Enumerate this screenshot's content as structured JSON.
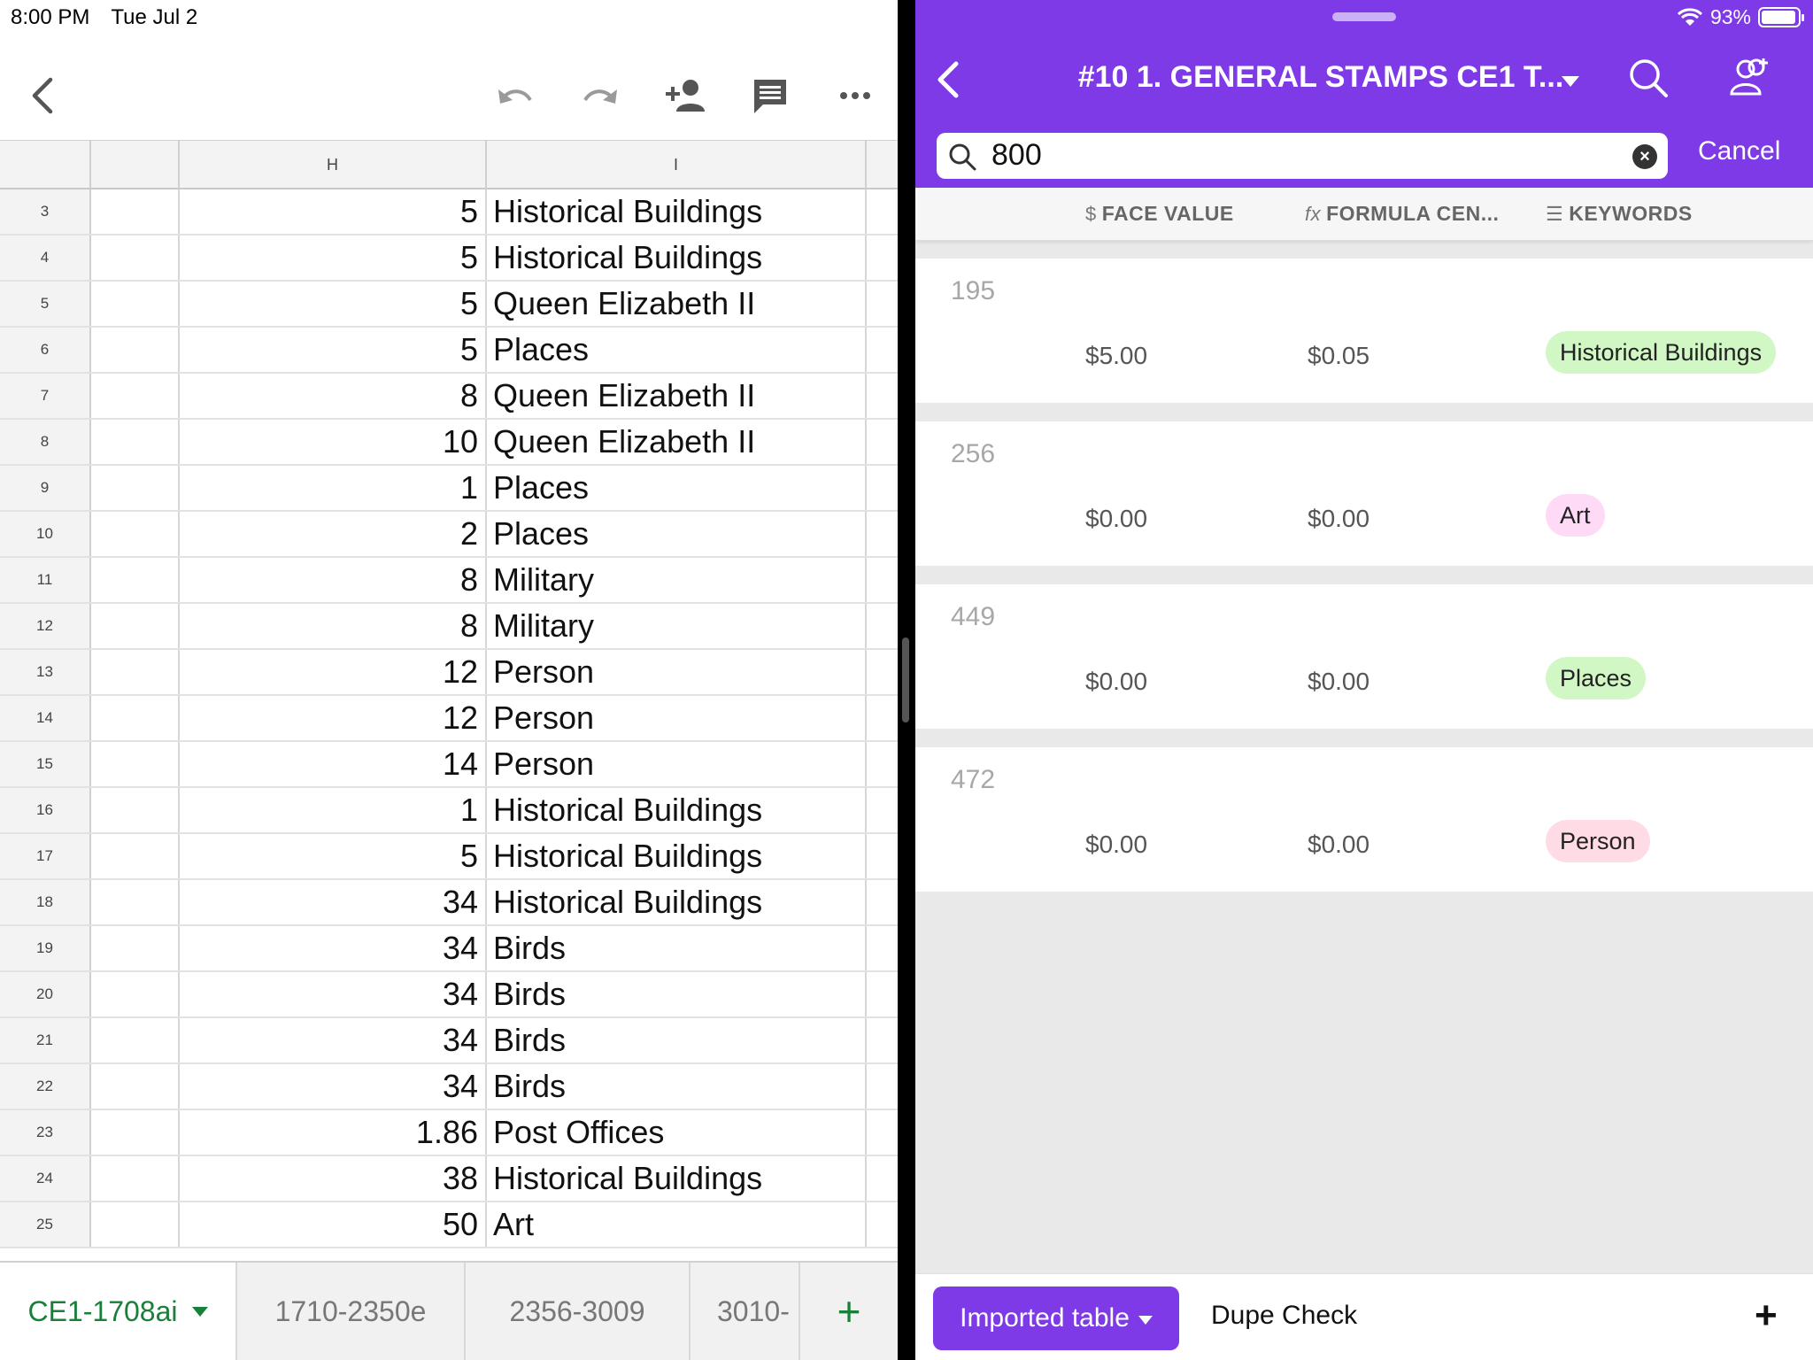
{
  "status_bar": {
    "time": "8:00 PM",
    "date": "Tue Jul 2",
    "battery": "93%"
  },
  "sheet": {
    "columns": {
      "h": "H",
      "i": "I"
    },
    "rows": [
      {
        "num": "3",
        "h": "5",
        "i": "Historical Buildings"
      },
      {
        "num": "4",
        "h": "5",
        "i": "Historical Buildings"
      },
      {
        "num": "5",
        "h": "5",
        "i": "Queen Elizabeth II"
      },
      {
        "num": "6",
        "h": "5",
        "i": "Places"
      },
      {
        "num": "7",
        "h": "8",
        "i": "Queen Elizabeth II"
      },
      {
        "num": "8",
        "h": "10",
        "i": "Queen Elizabeth II"
      },
      {
        "num": "9",
        "h": "1",
        "i": "Places"
      },
      {
        "num": "10",
        "h": "2",
        "i": "Places"
      },
      {
        "num": "11",
        "h": "8",
        "i": "Military"
      },
      {
        "num": "12",
        "h": "8",
        "i": "Military"
      },
      {
        "num": "13",
        "h": "12",
        "i": "Person"
      },
      {
        "num": "14",
        "h": "12",
        "i": "Person"
      },
      {
        "num": "15",
        "h": "14",
        "i": "Person"
      },
      {
        "num": "16",
        "h": "1",
        "i": "Historical Buildings"
      },
      {
        "num": "17",
        "h": "5",
        "i": "Historical Buildings"
      },
      {
        "num": "18",
        "h": "34",
        "i": "Historical Buildings"
      },
      {
        "num": "19",
        "h": "34",
        "i": "Birds"
      },
      {
        "num": "20",
        "h": "34",
        "i": "Birds"
      },
      {
        "num": "21",
        "h": "34",
        "i": "Birds"
      },
      {
        "num": "22",
        "h": "34",
        "i": "Birds"
      },
      {
        "num": "23",
        "h": "1.86",
        "i": "Post Offices"
      },
      {
        "num": "24",
        "h": "38",
        "i": "Historical Buildings"
      },
      {
        "num": "25",
        "h": "50",
        "i": "Art"
      }
    ],
    "tabs": [
      "CE1-1708ai",
      "1710-2350e",
      "2356-3009",
      "3010-"
    ],
    "accent": "#188038"
  },
  "airtable": {
    "title": "#10 1. GENERAL STAMPS CE1 T...",
    "search_value": "800",
    "cancel_label": "Cancel",
    "columns": {
      "face_value": "FACE VALUE",
      "formula": "FORMULA CEN...",
      "keywords": "KEYWORDS"
    },
    "records": [
      {
        "id": "195",
        "face_value": "$5.00",
        "formula": "$0.05",
        "keyword": "Historical Buildings",
        "keyword_color": "#d1f7c4"
      },
      {
        "id": "256",
        "face_value": "$0.00",
        "formula": "$0.00",
        "keyword": "Art",
        "keyword_color": "#ffdaf6"
      },
      {
        "id": "449",
        "face_value": "$0.00",
        "formula": "$0.00",
        "keyword": "Places",
        "keyword_color": "#d1f7c4"
      },
      {
        "id": "472",
        "face_value": "$0.00",
        "formula": "$0.00",
        "keyword": "Person",
        "keyword_color": "#ffdce5"
      }
    ],
    "bottom": {
      "table_label": "Imported table",
      "view_label": "Dupe Check"
    },
    "accent": "#7e3ae6"
  }
}
